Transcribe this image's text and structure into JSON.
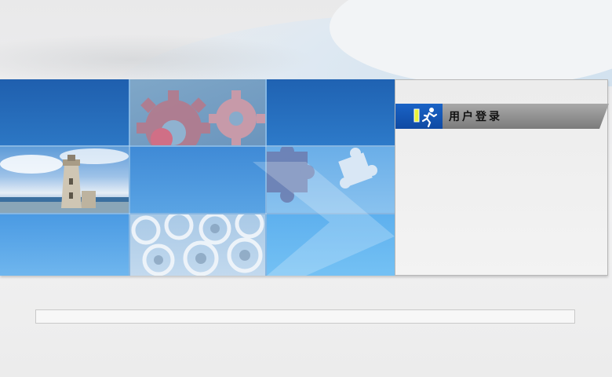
{
  "login": {
    "title": "用户登录",
    "icon": "running-person-icon"
  },
  "colors": {
    "accent_blue": "#1a63c6",
    "title_bar_gray": "#8c8c8c",
    "panel_bg": "#efefef"
  }
}
